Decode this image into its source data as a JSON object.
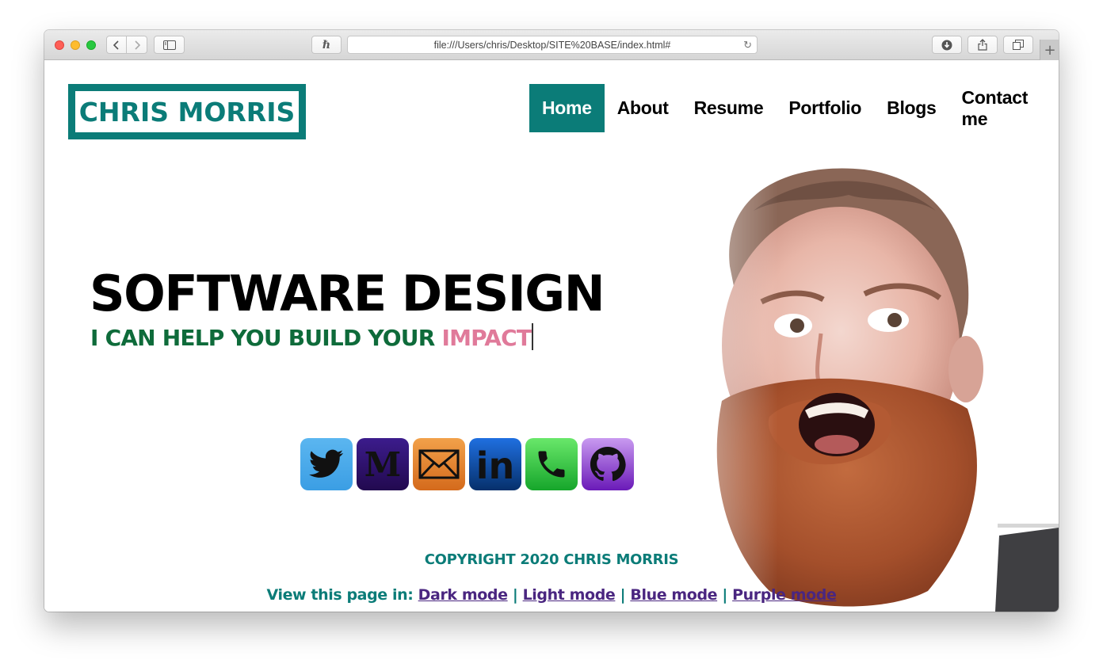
{
  "browser": {
    "url": "file:///Users/chris/Desktop/SITE%20BASE/index.html#"
  },
  "site": {
    "logo": "CHRIS MORRIS",
    "nav": [
      {
        "label": "Home",
        "active": true
      },
      {
        "label": "About"
      },
      {
        "label": "Resume"
      },
      {
        "label": "Portfolio"
      },
      {
        "label": "Blogs"
      },
      {
        "label": "Contact me"
      }
    ],
    "headline": "Software design",
    "tagline_prefix": "I can help you build your ",
    "tagline_highlight": "impact",
    "socials": [
      {
        "icon": "twitter-icon",
        "color": "#3b9ee4"
      },
      {
        "icon": "medium-icon",
        "color": "#22094f"
      },
      {
        "icon": "mail-icon",
        "color": "#d46a1c"
      },
      {
        "icon": "linkedin-icon",
        "color": "#06306b"
      },
      {
        "icon": "phone-icon",
        "color": "#16a62b"
      },
      {
        "icon": "github-icon",
        "color": "#6a1ab8"
      }
    ],
    "copyright": "Copyright 2020 Chris Morris",
    "modes_prefix": "View this page in:",
    "modes": [
      "Dark mode",
      "Light mode",
      "Blue mode",
      "Purple mode"
    ],
    "separator": "|"
  },
  "colors": {
    "accent": "#0b7c78",
    "tagline": "#0e6b3a",
    "highlight": "#e07a9a",
    "link": "#4a2680"
  }
}
